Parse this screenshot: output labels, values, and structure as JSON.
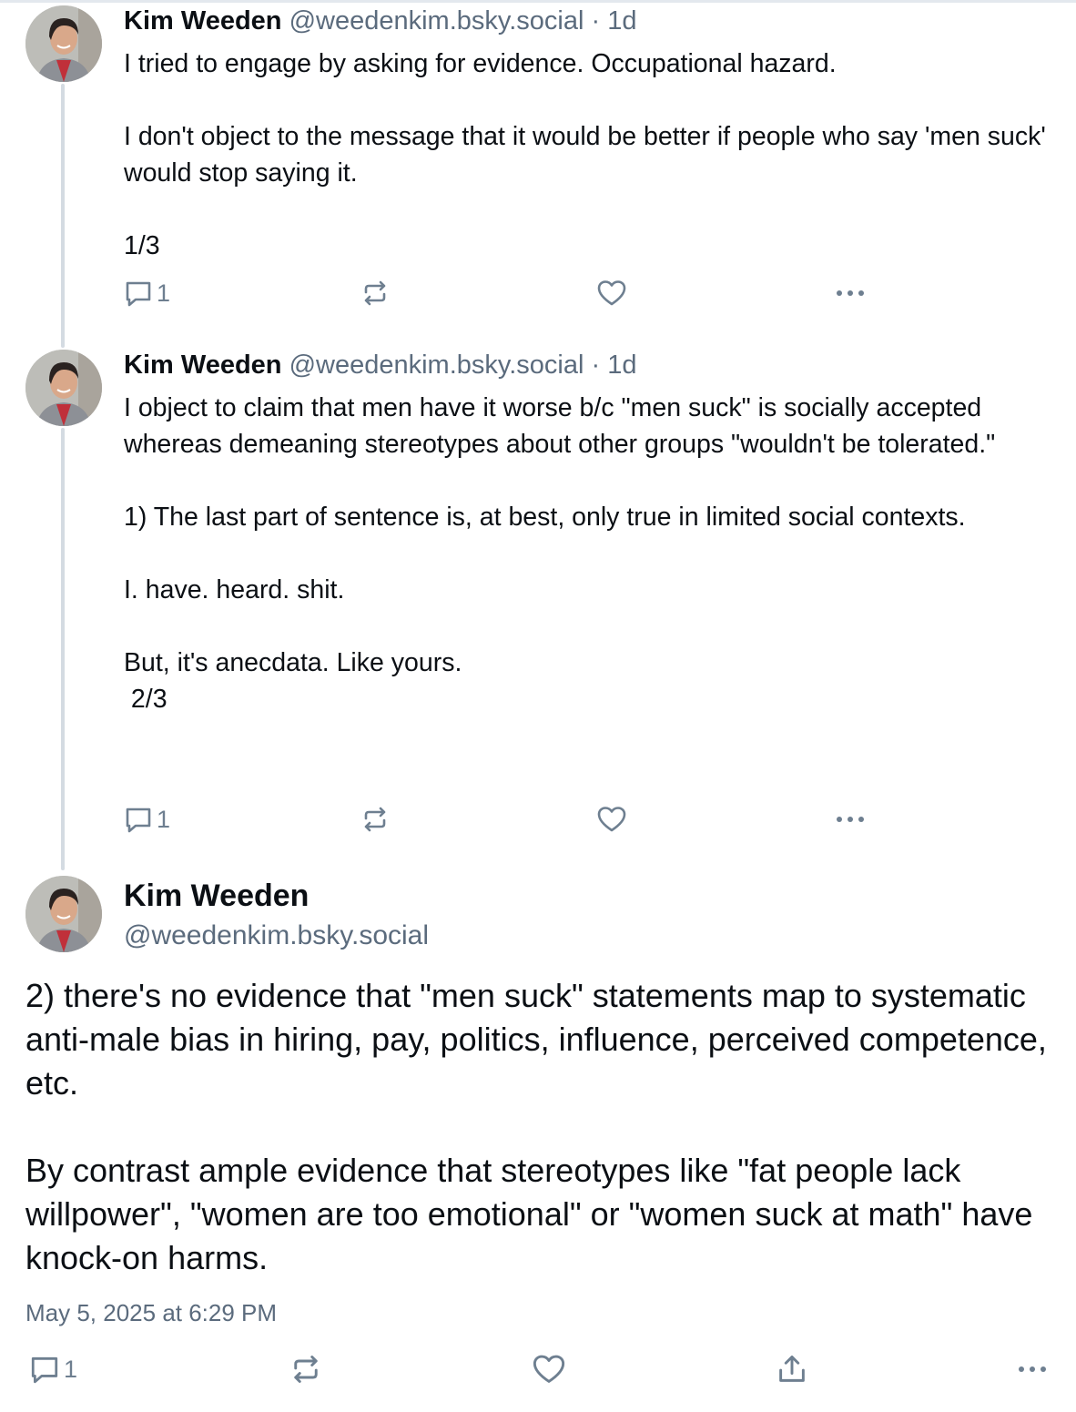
{
  "posts": [
    {
      "author": "Kim Weeden",
      "handle": "@weedenkim.bsky.social",
      "time": "· 1d",
      "text": "I tried to engage by asking for evidence. Occupational hazard.\n\nI don't object to the message that it would be better if people who say 'men suck' would stop saying it.\n\n1/3",
      "reply_count": "1"
    },
    {
      "author": "Kim Weeden",
      "handle": "@weedenkim.bsky.social",
      "time": "· 1d",
      "text": "I object to claim that men have it worse b/c \"men suck\" is socially accepted whereas demeaning stereotypes about other groups \"wouldn't be tolerated.\"\n\n1) The last part of sentence is, at best, only true in limited social contexts.\n\nI. have. heard. shit.\n\nBut, it's anecdata. Like yours.\n 2/3",
      "reply_count": "1"
    }
  ],
  "main_post": {
    "author": "Kim Weeden",
    "handle": "@weedenkim.bsky.social",
    "text": "2) there's no evidence that \"men suck\" statements map to systematic anti-male bias in hiring, pay, politics, influence, perceived competence, etc.\n\nBy contrast ample evidence that stereotypes like \"fat people lack willpower\", \"women are too emotional\" or \"women suck at math\" have knock-on harms.",
    "timestamp": "May 5, 2025 at 6:29 PM",
    "reply_count": "1"
  },
  "icons": [
    "avatar",
    "reply-icon",
    "repost-icon",
    "like-icon",
    "share-icon",
    "more-icon"
  ],
  "colors": {
    "text": "#0b0f14",
    "muted": "#5b6b7d",
    "icon": "#6e7f90",
    "thread_line": "#d4dbe2"
  }
}
